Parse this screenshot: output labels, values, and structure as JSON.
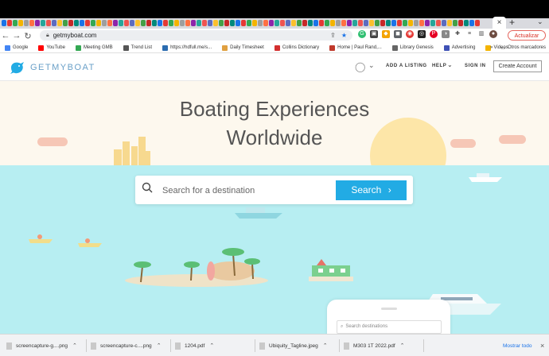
{
  "browser": {
    "active_tab_close": "×",
    "new_tab": "+",
    "url": "getmyboat.com",
    "update_label": "Actualizar",
    "bookmarks": [
      {
        "label": "Google",
        "color": "#4285f4"
      },
      {
        "label": "YouTube",
        "color": "#ff0000"
      },
      {
        "label": "Meeting GMB",
        "color": "#34a853"
      },
      {
        "label": "Trend List",
        "color": "#555555"
      },
      {
        "label": "https://hdfull.me/s...",
        "color": "#2b6cb0"
      },
      {
        "label": "Daily Timesheet",
        "color": "#e0a040"
      },
      {
        "label": "Collins Dictionary",
        "color": "#d32f2f"
      },
      {
        "label": "Home | Paul Rand,...",
        "color": "#c0392b"
      },
      {
        "label": "Library Genesis",
        "color": "#666666"
      },
      {
        "label": "Advertising",
        "color": "#3f51b5"
      },
      {
        "label": "Videos",
        "color": "#f4b400"
      }
    ],
    "bookmarks_more": "»",
    "other_bookmarks": "Otros marcadores"
  },
  "site": {
    "logo_text": "GETMYBOAT",
    "nav": {
      "add_listing": "ADD A LISTING",
      "help": "HELP",
      "sign_in": "SIGN IN",
      "create_account": "Create Account"
    },
    "hero": {
      "title_line1": "Boating Experiences",
      "title_line2": "Worldwide"
    },
    "search": {
      "placeholder": "Search for a destination",
      "button_label": "Search"
    },
    "phone": {
      "placeholder": "Search destinations"
    }
  },
  "downloads": {
    "items": [
      {
        "name": "screencapture-g....png"
      },
      {
        "name": "screencapture-c....png"
      },
      {
        "name": "1204.pdf"
      },
      {
        "name": "Ubiquity_Tagline.jpeg"
      },
      {
        "name": "M303 1T 2022.pdf"
      }
    ],
    "show_all": "Mostrar todo",
    "close": "×"
  },
  "colors": {
    "brand_blue": "#22abe4",
    "sea": "#b7eef2",
    "sun": "#fde6a8"
  }
}
